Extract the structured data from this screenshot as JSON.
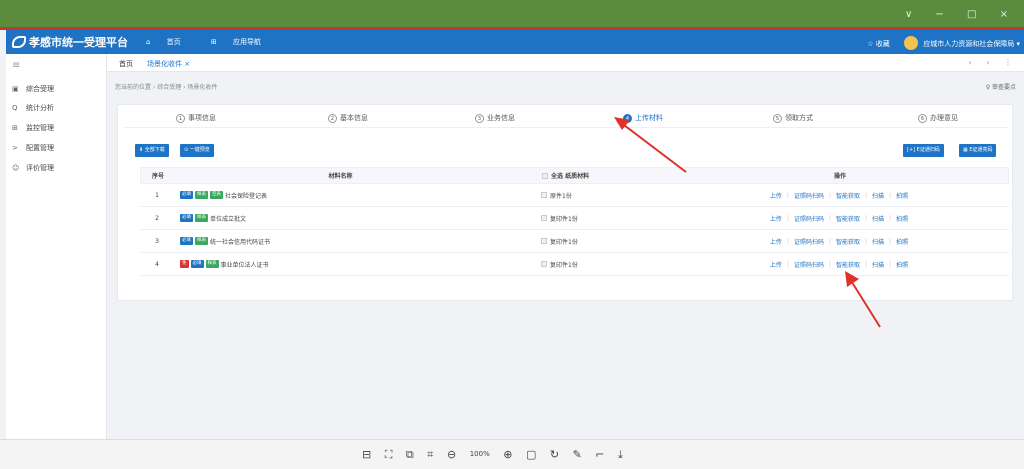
{
  "window": {
    "controls": "∨  −  □  ×"
  },
  "app": {
    "title": "孝感市统一受理平台",
    "nav": [
      {
        "label": "首页",
        "icon": "home-icon"
      },
      {
        "label": "应用导航",
        "icon": "grid-icon"
      }
    ],
    "favorite": "☆ 收藏",
    "user": "应城市人力资源和社会保障局 ▾"
  },
  "sidebar": {
    "items": [
      {
        "label": "综合受理",
        "icon": "document-icon"
      },
      {
        "label": "统计分析",
        "icon": "search-icon"
      },
      {
        "label": "监控管理",
        "icon": "grid-icon"
      },
      {
        "label": "配置管理",
        "icon": "share-icon"
      },
      {
        "label": "评价管理",
        "icon": "smile-icon"
      }
    ]
  },
  "tabs": [
    {
      "label": "首页",
      "active": false
    },
    {
      "label": "场景化收件 ×",
      "active": true
    }
  ],
  "breadcrumb": "您当前的位置 › 综合受理 › 场景化收件",
  "review_tip": "♀ 审查要点",
  "steps": [
    {
      "num": "1",
      "label": "事项信息",
      "active": false
    },
    {
      "num": "2",
      "label": "基本信息",
      "active": false
    },
    {
      "num": "3",
      "label": "业务信息",
      "active": false
    },
    {
      "num": "4",
      "label": "上传材料",
      "active": true
    },
    {
      "num": "5",
      "label": "领取方式",
      "active": false
    },
    {
      "num": "6",
      "label": "办理意见",
      "active": false
    }
  ],
  "buttons": {
    "download_all": "⬇ 全部下载",
    "preview": "⊙ 一键预览",
    "e_scan": "[+] E证通扫码",
    "e_code": "▦ E证通亮码"
  },
  "table": {
    "headers": {
      "index": "序号",
      "name": "材料名称",
      "paper": "全选 纸质材料",
      "ops": "操作"
    },
    "rows": [
      {
        "index": "1",
        "tags": [
          {
            "text": "必填",
            "color": "blue"
          },
          {
            "text": "样表",
            "color": "green"
          },
          {
            "text": "空表",
            "color": "green"
          }
        ],
        "name": "社会保险登记表",
        "paper": "原件1份"
      },
      {
        "index": "2",
        "tags": [
          {
            "text": "必填",
            "color": "blue"
          },
          {
            "text": "样表",
            "color": "green"
          }
        ],
        "name": "单位成立批文",
        "paper": "复印件1份"
      },
      {
        "index": "3",
        "tags": [
          {
            "text": "必填",
            "color": "blue"
          },
          {
            "text": "样表",
            "color": "green"
          }
        ],
        "name": "统一社会信用代码证书",
        "paper": "复印件1份"
      },
      {
        "index": "4",
        "tags": [
          {
            "text": "免",
            "color": "red"
          },
          {
            "text": "必填",
            "color": "blue"
          },
          {
            "text": "样表",
            "color": "green"
          }
        ],
        "name": "事业单位法人证书",
        "paper": "复印件1份"
      }
    ],
    "ops": [
      "上传",
      "证照码扫码",
      "智能获取",
      "扫描",
      "拍照"
    ]
  },
  "viewer_tools": {
    "zoom": "100%"
  },
  "colors": {
    "primary": "#1e73c5",
    "green": "#3aa85e",
    "red": "#d9362f",
    "titlebar": "#5b8c3e",
    "annotation": "#e0312a"
  }
}
